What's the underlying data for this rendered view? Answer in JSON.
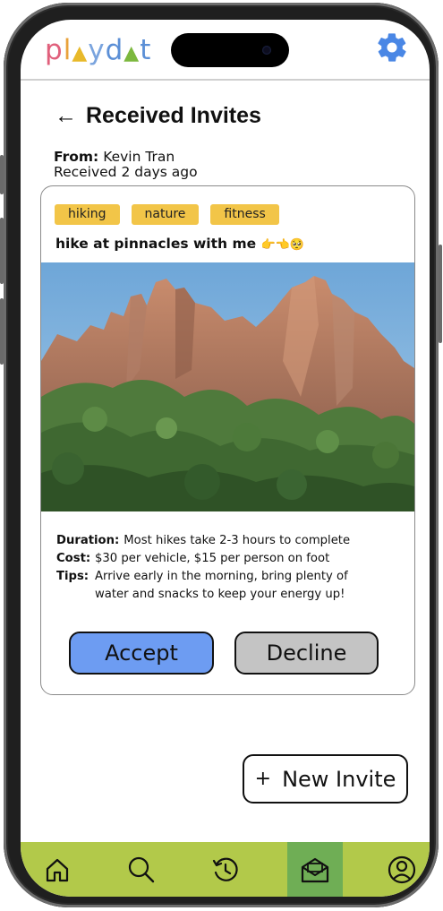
{
  "app": {
    "logo_parts": [
      "pl",
      "y",
      "dat"
    ],
    "colors": {
      "tag_bg": "#f2c548",
      "accept_bg": "#6d9cf2",
      "decline_bg": "#c4c4c4",
      "tabbar_bg": "#b2c94a",
      "tab_active_bg": "#6fae55"
    },
    "settings_icon": "gear-icon"
  },
  "page": {
    "title": "Received Invites",
    "back_icon": "back-arrow-icon"
  },
  "invite": {
    "from_label": "From:",
    "from_name": "Kevin Tran",
    "received": "Received 2 days ago",
    "tags": [
      "hiking",
      "nature",
      "fitness"
    ],
    "title": "hike at pinnacles with me",
    "title_emoji": "👉👈🥺",
    "details": {
      "duration_label": "Duration:",
      "duration_value": "Most hikes take 2-3 hours to complete",
      "cost_label": "Cost:",
      "cost_value": "$30 per vehicle, $15 per person on foot",
      "tips_label": "Tips:",
      "tips_value_line1": "Arrive early in the morning, bring plenty of",
      "tips_value_line2": "water and snacks to keep your energy up!"
    },
    "accept_label": "Accept",
    "decline_label": "Decline"
  },
  "new_invite": {
    "plus": "+",
    "label": "New Invite"
  },
  "tabbar": {
    "items": [
      {
        "icon": "home-icon"
      },
      {
        "icon": "search-icon"
      },
      {
        "icon": "history-icon"
      },
      {
        "icon": "inbox-icon",
        "active": true
      },
      {
        "icon": "profile-icon"
      }
    ]
  }
}
